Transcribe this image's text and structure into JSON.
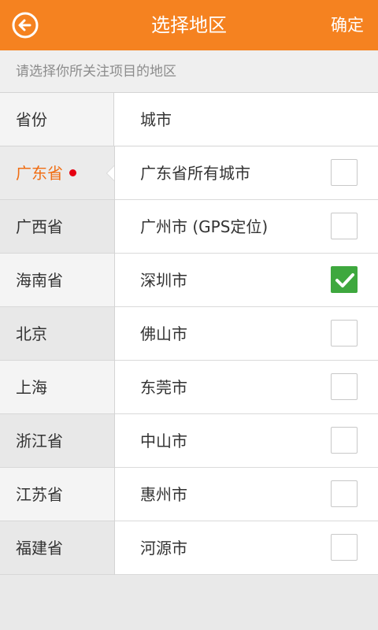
{
  "header": {
    "title": "选择地区",
    "confirm_label": "确定",
    "back_icon": "back-arrow-circle-icon"
  },
  "hint": "请选择你所关注项目的地区",
  "columns": {
    "province": "省份",
    "city": "城市"
  },
  "provinces": [
    {
      "label": "广东省",
      "selected": true
    },
    {
      "label": "广西省"
    },
    {
      "label": "海南省"
    },
    {
      "label": "北京"
    },
    {
      "label": "上海"
    },
    {
      "label": "浙江省"
    },
    {
      "label": "江苏省"
    },
    {
      "label": "福建省"
    }
  ],
  "cities": [
    {
      "label": "广东省所有城市",
      "checked": false
    },
    {
      "label": "广州市 (GPS定位)",
      "checked": false
    },
    {
      "label": "深圳市",
      "checked": true
    },
    {
      "label": "佛山市",
      "checked": false
    },
    {
      "label": "东莞市",
      "checked": false
    },
    {
      "label": "中山市",
      "checked": false
    },
    {
      "label": "惠州市",
      "checked": false
    },
    {
      "label": "河源市",
      "checked": false
    }
  ],
  "colors": {
    "accent": "#f58220",
    "selected_text": "#f06e14",
    "dot": "#e50012",
    "check": "#3ea83e"
  }
}
